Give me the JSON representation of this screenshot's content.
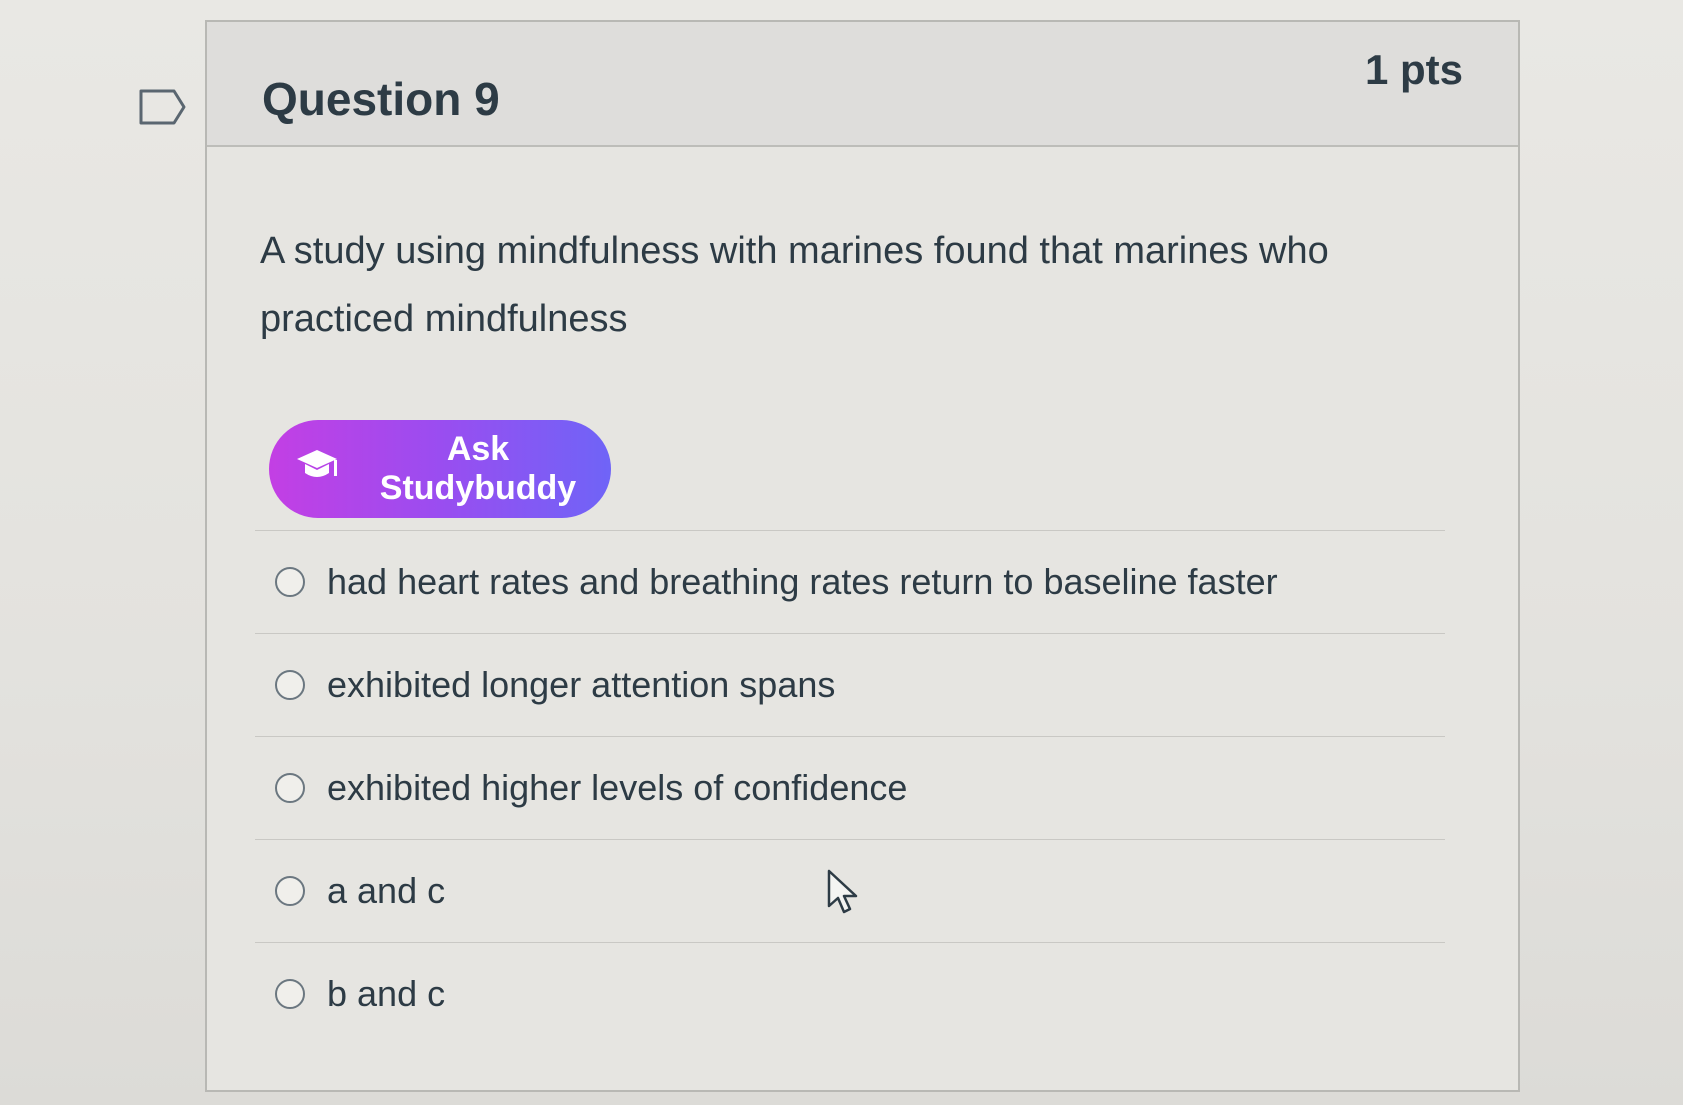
{
  "question": {
    "title": "Question 9",
    "points": "1 pts",
    "text": "A study using mindfulness with marines found that marines who practiced mindfulness"
  },
  "studybuddy": {
    "label": "Ask Studybuddy",
    "icon": "graduation-cap-icon",
    "gradient_colors": [
      "#c33fe4",
      "#6f64f7"
    ]
  },
  "answers": [
    {
      "label": "had heart rates and breathing rates return to baseline faster",
      "selected": false
    },
    {
      "label": "exhibited longer attention spans",
      "selected": false
    },
    {
      "label": "exhibited higher levels of confidence",
      "selected": false
    },
    {
      "label": "a and c",
      "selected": false
    },
    {
      "label": "b and c",
      "selected": false
    }
  ],
  "icons": {
    "flag": "flag-icon",
    "cursor": "mouse-pointer-icon"
  }
}
